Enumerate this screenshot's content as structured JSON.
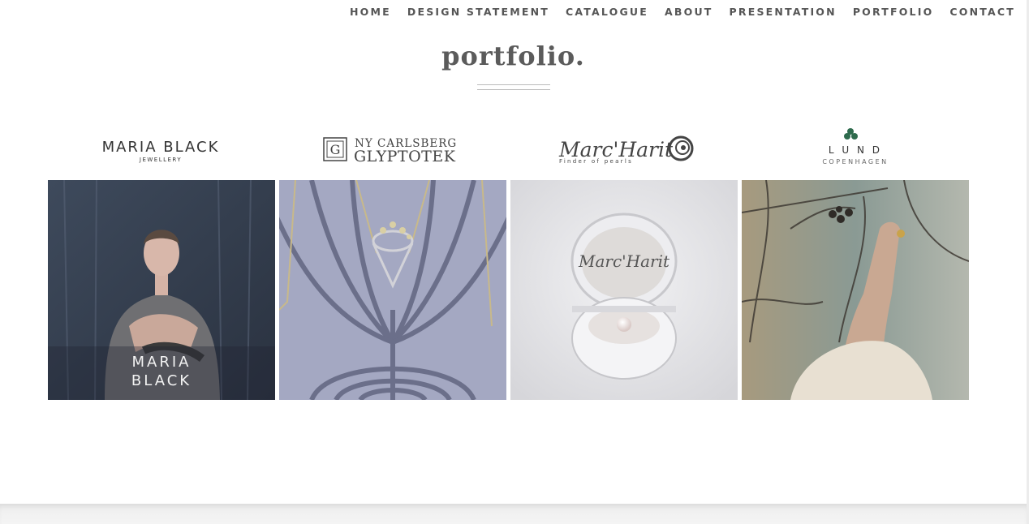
{
  "nav": {
    "items": [
      {
        "label": "HOME"
      },
      {
        "label": "DESIGN STATEMENT"
      },
      {
        "label": "CATALOGUE"
      },
      {
        "label": "ABOUT"
      },
      {
        "label": "PRESENTATION"
      },
      {
        "label": "PORTFOLIO"
      },
      {
        "label": "CONTACT"
      }
    ]
  },
  "page": {
    "title": "portfolio."
  },
  "logos": {
    "maria_black": {
      "name": "MARIA BLACK",
      "sub": "JEWELLERY"
    },
    "glyptotek": {
      "line1": "NY CARLSBERG",
      "line2": "GLYPTOTEK"
    },
    "marc_harit": {
      "name": "Marc'Harit",
      "sub": "Finder of pearls"
    },
    "lund": {
      "name": "L U N D",
      "sub": "COPENHAGEN"
    }
  },
  "tiles": [
    {
      "caption": "MARIA\nBLACK"
    }
  ],
  "colors": {
    "nav_text": "#555555",
    "title_text": "#5b5b5b",
    "lund_clover": "#2e6b4d"
  }
}
